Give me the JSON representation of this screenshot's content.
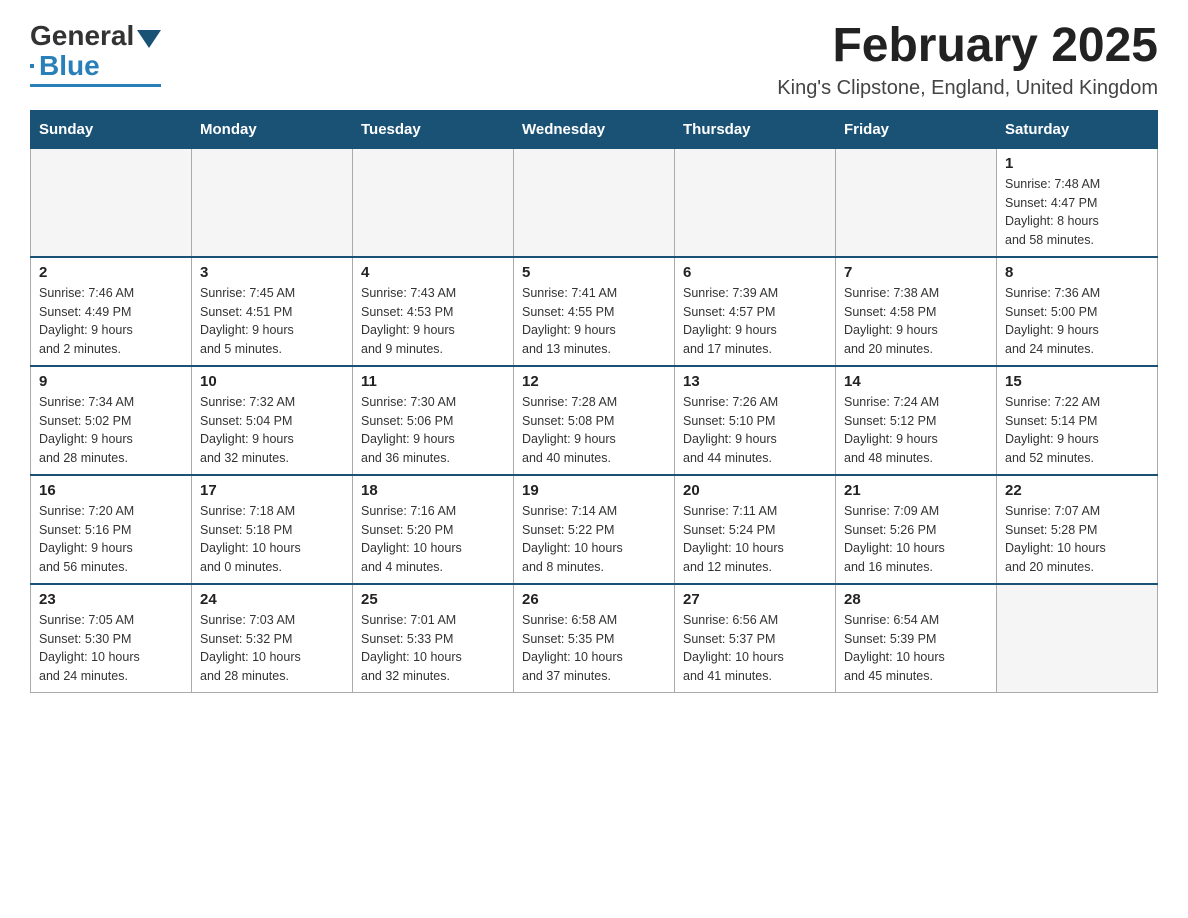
{
  "header": {
    "logo": {
      "general": "General",
      "blue": "Blue"
    },
    "title": "February 2025",
    "location": "King's Clipstone, England, United Kingdom"
  },
  "weekdays": [
    "Sunday",
    "Monday",
    "Tuesday",
    "Wednesday",
    "Thursday",
    "Friday",
    "Saturday"
  ],
  "weeks": [
    [
      {
        "day": "",
        "info": ""
      },
      {
        "day": "",
        "info": ""
      },
      {
        "day": "",
        "info": ""
      },
      {
        "day": "",
        "info": ""
      },
      {
        "day": "",
        "info": ""
      },
      {
        "day": "",
        "info": ""
      },
      {
        "day": "1",
        "info": "Sunrise: 7:48 AM\nSunset: 4:47 PM\nDaylight: 8 hours\nand 58 minutes."
      }
    ],
    [
      {
        "day": "2",
        "info": "Sunrise: 7:46 AM\nSunset: 4:49 PM\nDaylight: 9 hours\nand 2 minutes."
      },
      {
        "day": "3",
        "info": "Sunrise: 7:45 AM\nSunset: 4:51 PM\nDaylight: 9 hours\nand 5 minutes."
      },
      {
        "day": "4",
        "info": "Sunrise: 7:43 AM\nSunset: 4:53 PM\nDaylight: 9 hours\nand 9 minutes."
      },
      {
        "day": "5",
        "info": "Sunrise: 7:41 AM\nSunset: 4:55 PM\nDaylight: 9 hours\nand 13 minutes."
      },
      {
        "day": "6",
        "info": "Sunrise: 7:39 AM\nSunset: 4:57 PM\nDaylight: 9 hours\nand 17 minutes."
      },
      {
        "day": "7",
        "info": "Sunrise: 7:38 AM\nSunset: 4:58 PM\nDaylight: 9 hours\nand 20 minutes."
      },
      {
        "day": "8",
        "info": "Sunrise: 7:36 AM\nSunset: 5:00 PM\nDaylight: 9 hours\nand 24 minutes."
      }
    ],
    [
      {
        "day": "9",
        "info": "Sunrise: 7:34 AM\nSunset: 5:02 PM\nDaylight: 9 hours\nand 28 minutes."
      },
      {
        "day": "10",
        "info": "Sunrise: 7:32 AM\nSunset: 5:04 PM\nDaylight: 9 hours\nand 32 minutes."
      },
      {
        "day": "11",
        "info": "Sunrise: 7:30 AM\nSunset: 5:06 PM\nDaylight: 9 hours\nand 36 minutes."
      },
      {
        "day": "12",
        "info": "Sunrise: 7:28 AM\nSunset: 5:08 PM\nDaylight: 9 hours\nand 40 minutes."
      },
      {
        "day": "13",
        "info": "Sunrise: 7:26 AM\nSunset: 5:10 PM\nDaylight: 9 hours\nand 44 minutes."
      },
      {
        "day": "14",
        "info": "Sunrise: 7:24 AM\nSunset: 5:12 PM\nDaylight: 9 hours\nand 48 minutes."
      },
      {
        "day": "15",
        "info": "Sunrise: 7:22 AM\nSunset: 5:14 PM\nDaylight: 9 hours\nand 52 minutes."
      }
    ],
    [
      {
        "day": "16",
        "info": "Sunrise: 7:20 AM\nSunset: 5:16 PM\nDaylight: 9 hours\nand 56 minutes."
      },
      {
        "day": "17",
        "info": "Sunrise: 7:18 AM\nSunset: 5:18 PM\nDaylight: 10 hours\nand 0 minutes."
      },
      {
        "day": "18",
        "info": "Sunrise: 7:16 AM\nSunset: 5:20 PM\nDaylight: 10 hours\nand 4 minutes."
      },
      {
        "day": "19",
        "info": "Sunrise: 7:14 AM\nSunset: 5:22 PM\nDaylight: 10 hours\nand 8 minutes."
      },
      {
        "day": "20",
        "info": "Sunrise: 7:11 AM\nSunset: 5:24 PM\nDaylight: 10 hours\nand 12 minutes."
      },
      {
        "day": "21",
        "info": "Sunrise: 7:09 AM\nSunset: 5:26 PM\nDaylight: 10 hours\nand 16 minutes."
      },
      {
        "day": "22",
        "info": "Sunrise: 7:07 AM\nSunset: 5:28 PM\nDaylight: 10 hours\nand 20 minutes."
      }
    ],
    [
      {
        "day": "23",
        "info": "Sunrise: 7:05 AM\nSunset: 5:30 PM\nDaylight: 10 hours\nand 24 minutes."
      },
      {
        "day": "24",
        "info": "Sunrise: 7:03 AM\nSunset: 5:32 PM\nDaylight: 10 hours\nand 28 minutes."
      },
      {
        "day": "25",
        "info": "Sunrise: 7:01 AM\nSunset: 5:33 PM\nDaylight: 10 hours\nand 32 minutes."
      },
      {
        "day": "26",
        "info": "Sunrise: 6:58 AM\nSunset: 5:35 PM\nDaylight: 10 hours\nand 37 minutes."
      },
      {
        "day": "27",
        "info": "Sunrise: 6:56 AM\nSunset: 5:37 PM\nDaylight: 10 hours\nand 41 minutes."
      },
      {
        "day": "28",
        "info": "Sunrise: 6:54 AM\nSunset: 5:39 PM\nDaylight: 10 hours\nand 45 minutes."
      },
      {
        "day": "",
        "info": ""
      }
    ]
  ]
}
